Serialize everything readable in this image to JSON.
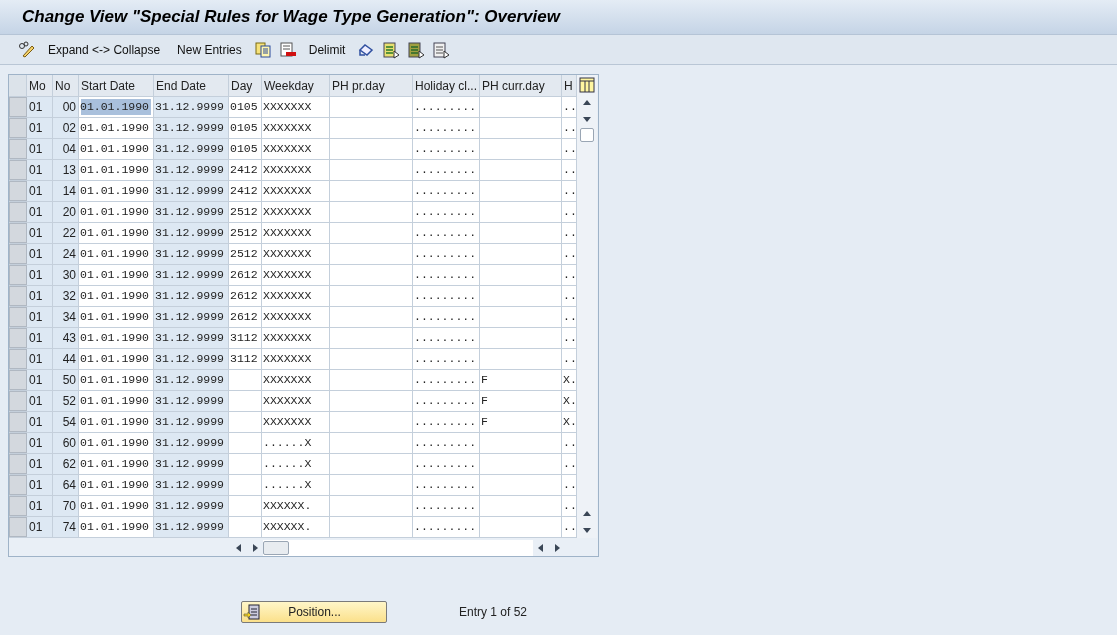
{
  "window": {
    "title": "Change View \"Special Rules for Wage Type Generation\": Overview"
  },
  "toolbar": [
    {
      "kind": "icon"
    },
    {
      "kind": "text",
      "label": "Expand <-> Collapse"
    },
    {
      "kind": "text",
      "label": "New Entries"
    },
    {
      "kind": "icon"
    },
    {
      "kind": "icon"
    },
    {
      "kind": "text",
      "label": "Delimit"
    },
    {
      "kind": "icon"
    },
    {
      "kind": "icon"
    },
    {
      "kind": "icon"
    },
    {
      "kind": "icon"
    }
  ],
  "table": {
    "columns": [
      "Mo",
      "No",
      "Start Date",
      "End Date",
      "Day",
      "Weekday",
      "PH pr.day",
      "Holiday cl...",
      "PH curr.day",
      "H"
    ],
    "rows": [
      {
        "selected": true,
        "cells": [
          "01",
          "00",
          "01.01.1990",
          "31.12.9999",
          "0105",
          "XXXXXXX",
          "",
          ".........",
          "",
          ".."
        ]
      },
      {
        "selected": false,
        "cells": [
          "01",
          "02",
          "01.01.1990",
          "31.12.9999",
          "0105",
          "XXXXXXX",
          "",
          ".........",
          "",
          ".."
        ]
      },
      {
        "selected": false,
        "cells": [
          "01",
          "04",
          "01.01.1990",
          "31.12.9999",
          "0105",
          "XXXXXXX",
          "",
          ".........",
          "",
          ".."
        ]
      },
      {
        "selected": false,
        "cells": [
          "01",
          "13",
          "01.01.1990",
          "31.12.9999",
          "2412",
          "XXXXXXX",
          "",
          ".........",
          "",
          ".."
        ]
      },
      {
        "selected": false,
        "cells": [
          "01",
          "14",
          "01.01.1990",
          "31.12.9999",
          "2412",
          "XXXXXXX",
          "",
          ".........",
          "",
          ".."
        ]
      },
      {
        "selected": false,
        "cells": [
          "01",
          "20",
          "01.01.1990",
          "31.12.9999",
          "2512",
          "XXXXXXX",
          "",
          ".........",
          "",
          ".."
        ]
      },
      {
        "selected": false,
        "cells": [
          "01",
          "22",
          "01.01.1990",
          "31.12.9999",
          "2512",
          "XXXXXXX",
          "",
          ".........",
          "",
          ".."
        ]
      },
      {
        "selected": false,
        "cells": [
          "01",
          "24",
          "01.01.1990",
          "31.12.9999",
          "2512",
          "XXXXXXX",
          "",
          ".........",
          "",
          ".."
        ]
      },
      {
        "selected": false,
        "cells": [
          "01",
          "30",
          "01.01.1990",
          "31.12.9999",
          "2612",
          "XXXXXXX",
          "",
          ".........",
          "",
          ".."
        ]
      },
      {
        "selected": false,
        "cells": [
          "01",
          "32",
          "01.01.1990",
          "31.12.9999",
          "2612",
          "XXXXXXX",
          "",
          ".........",
          "",
          ".."
        ]
      },
      {
        "selected": false,
        "cells": [
          "01",
          "34",
          "01.01.1990",
          "31.12.9999",
          "2612",
          "XXXXXXX",
          "",
          ".........",
          "",
          ".."
        ]
      },
      {
        "selected": false,
        "cells": [
          "01",
          "43",
          "01.01.1990",
          "31.12.9999",
          "3112",
          "XXXXXXX",
          "",
          ".........",
          "",
          ".."
        ]
      },
      {
        "selected": false,
        "cells": [
          "01",
          "44",
          "01.01.1990",
          "31.12.9999",
          "3112",
          "XXXXXXX",
          "",
          ".........",
          "",
          ".."
        ]
      },
      {
        "selected": false,
        "cells": [
          "01",
          "50",
          "01.01.1990",
          "31.12.9999",
          "",
          "XXXXXXX",
          "",
          ".........",
          "F",
          "X."
        ]
      },
      {
        "selected": false,
        "cells": [
          "01",
          "52",
          "01.01.1990",
          "31.12.9999",
          "",
          "XXXXXXX",
          "",
          ".........",
          "F",
          "X."
        ]
      },
      {
        "selected": false,
        "cells": [
          "01",
          "54",
          "01.01.1990",
          "31.12.9999",
          "",
          "XXXXXXX",
          "",
          ".........",
          "F",
          "X."
        ]
      },
      {
        "selected": false,
        "cells": [
          "01",
          "60",
          "01.01.1990",
          "31.12.9999",
          "",
          "......X",
          "",
          ".........",
          "",
          ".."
        ]
      },
      {
        "selected": false,
        "cells": [
          "01",
          "62",
          "01.01.1990",
          "31.12.9999",
          "",
          "......X",
          "",
          ".........",
          "",
          ".."
        ]
      },
      {
        "selected": false,
        "cells": [
          "01",
          "64",
          "01.01.1990",
          "31.12.9999",
          "",
          "......X",
          "",
          ".........",
          "",
          ".."
        ]
      },
      {
        "selected": false,
        "cells": [
          "01",
          "70",
          "01.01.1990",
          "31.12.9999",
          "",
          "XXXXXX.",
          "",
          ".........",
          "",
          ".."
        ]
      },
      {
        "selected": false,
        "cells": [
          "01",
          "74",
          "01.01.1990",
          "31.12.9999",
          "",
          "XXXXXX.",
          "",
          ".........",
          "",
          ".."
        ]
      }
    ]
  },
  "footer": {
    "button": "Position...",
    "entry_info": "Entry 1 of 52"
  }
}
